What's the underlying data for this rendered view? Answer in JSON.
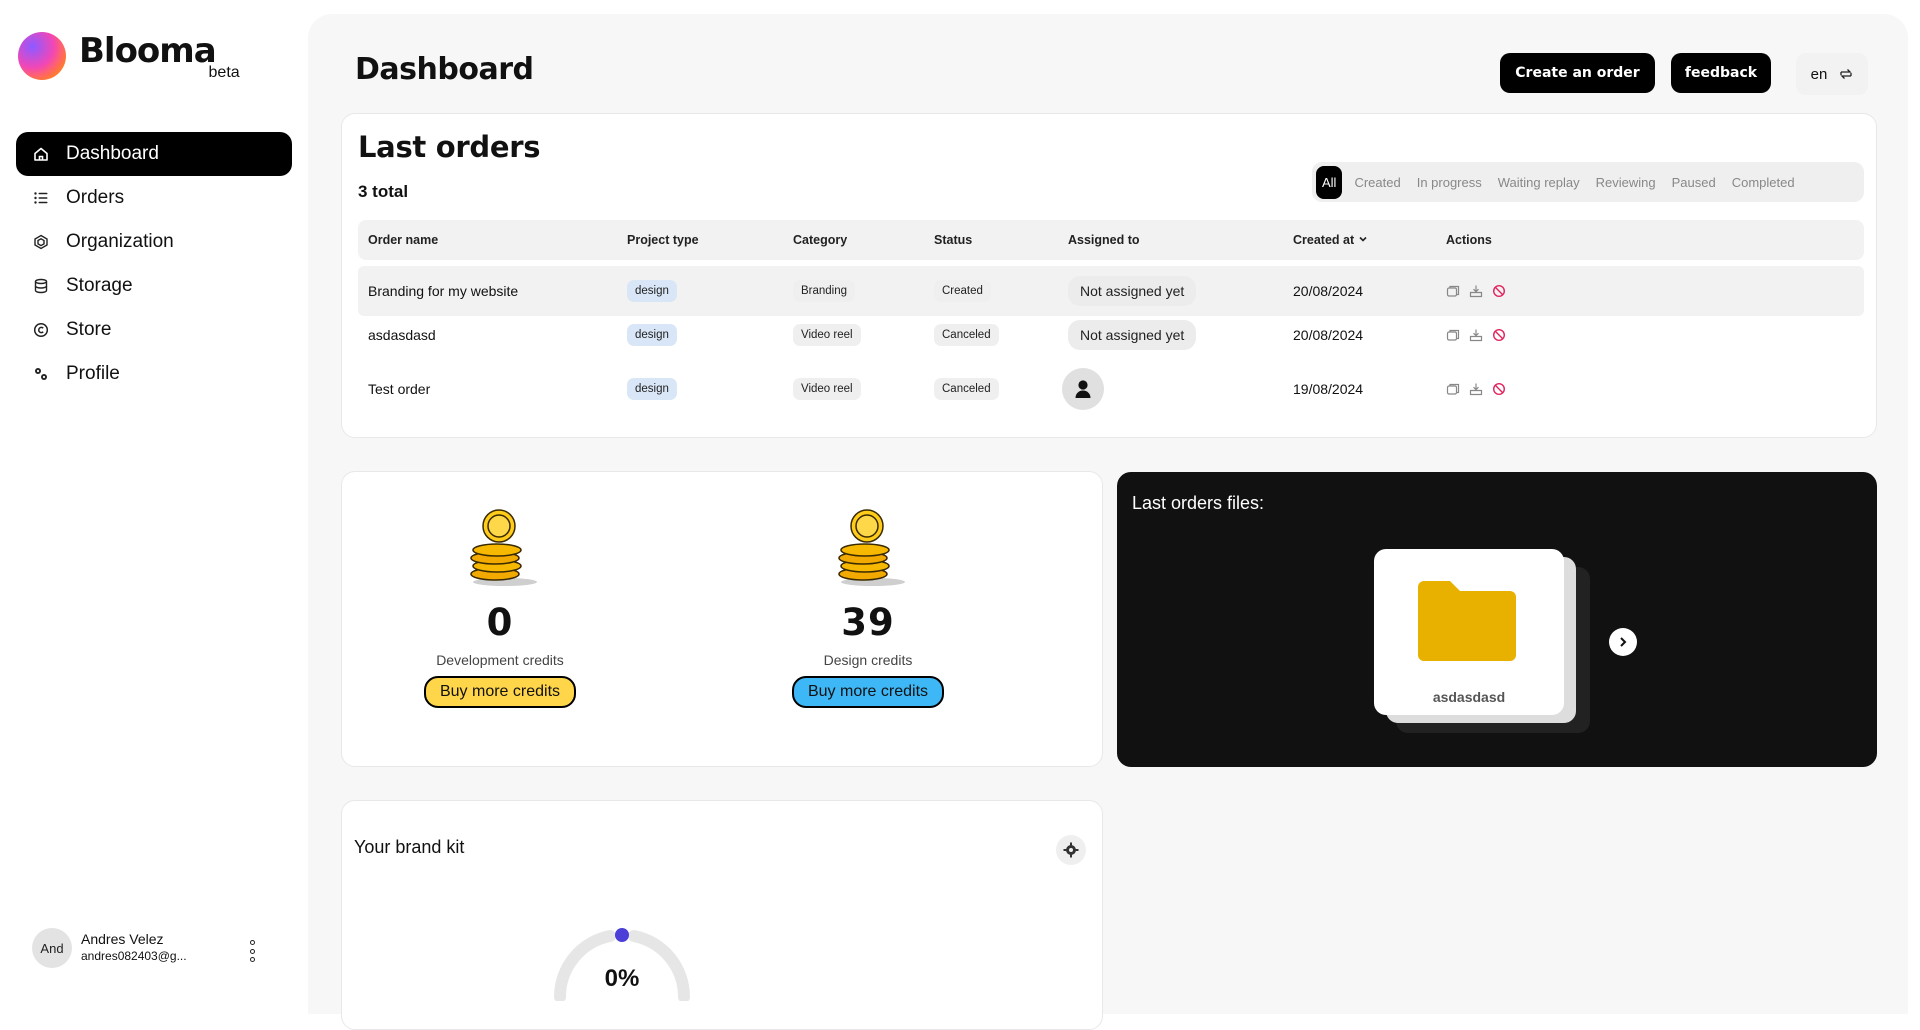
{
  "app": {
    "name": "Blooma",
    "tag": "beta"
  },
  "sidebar": {
    "items": [
      {
        "label": "Dashboard",
        "icon": "home-icon",
        "active": true
      },
      {
        "label": "Orders",
        "icon": "list-icon"
      },
      {
        "label": "Organization",
        "icon": "organization-icon"
      },
      {
        "label": "Storage",
        "icon": "database-icon"
      },
      {
        "label": "Store",
        "icon": "copyright-icon"
      },
      {
        "label": "Profile",
        "icon": "gears-icon"
      }
    ],
    "user": {
      "initials": "And",
      "name": "Andres Velez",
      "email": "andres082403@g..."
    }
  },
  "header": {
    "title": "Dashboard",
    "create_order": "Create an order",
    "feedback": "feedback",
    "language": "en"
  },
  "orders": {
    "title": "Last orders",
    "total": "3 total",
    "filters": [
      "All",
      "Created",
      "In progress",
      "Waiting replay",
      "Reviewing",
      "Paused",
      "Completed"
    ],
    "active_filter": "All",
    "columns": [
      "Order name",
      "Project type",
      "Category",
      "Status",
      "Assigned to",
      "Created at",
      "Actions"
    ],
    "rows": [
      {
        "name": "Branding for my website",
        "project_type": "design",
        "category": "Branding",
        "status": "Created",
        "assigned": "Not assigned yet",
        "created": "20/08/2024"
      },
      {
        "name": "asdasdasd",
        "project_type": "design",
        "category": "Video reel",
        "status": "Canceled",
        "assigned": "Not assigned yet",
        "created": "20/08/2024"
      },
      {
        "name": "Test order",
        "project_type": "design",
        "category": "Video reel",
        "status": "Canceled",
        "assigned": "",
        "created": "19/08/2024"
      }
    ]
  },
  "credits": {
    "development": {
      "value": "0",
      "label": "Development credits",
      "button": "Buy more credits",
      "color": "#ffd54a"
    },
    "design": {
      "value": "39",
      "label": "Design credits",
      "button": "Buy more credits",
      "color": "#3db7f5"
    }
  },
  "files": {
    "title": "Last orders files:",
    "folder_name": "asdasdasd",
    "folder_color": "#e8b100"
  },
  "brand_kit": {
    "title": "Your brand kit",
    "progress_label": "0%",
    "progress": 0
  }
}
